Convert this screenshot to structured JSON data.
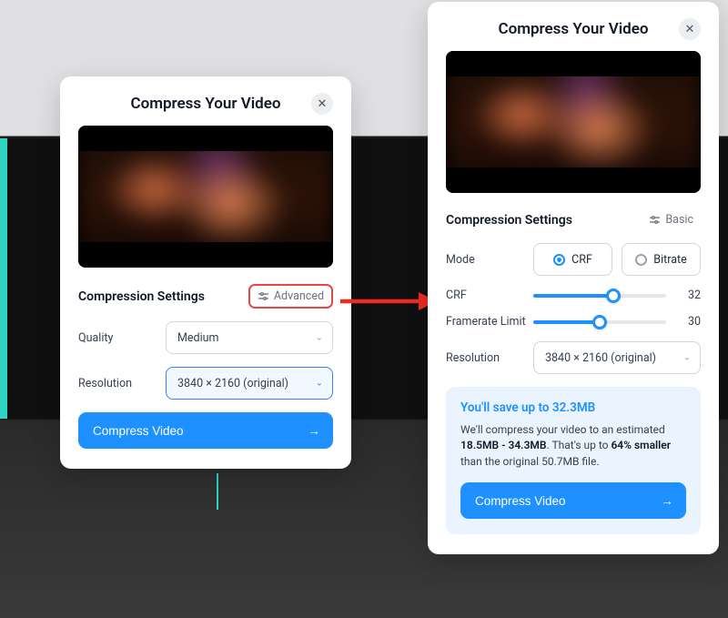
{
  "left": {
    "title": "Compress Your Video",
    "section": "Compression Settings",
    "toggle": "Advanced",
    "quality_label": "Quality",
    "quality_value": "Medium",
    "resolution_label": "Resolution",
    "resolution_value": "3840 × 2160 (original)",
    "button": "Compress Video"
  },
  "right": {
    "title": "Compress Your Video",
    "section": "Compression Settings",
    "toggle": "Basic",
    "mode_label": "Mode",
    "mode_crf": "CRF",
    "mode_bitrate": "Bitrate",
    "crf_label": "CRF",
    "crf_value": "32",
    "fps_label": "Framerate Limit",
    "fps_value": "30",
    "resolution_label": "Resolution",
    "resolution_value": "3840 × 2160 (original)",
    "info_title": "You'll save up to 32.3MB",
    "info_prefix": "We'll compress your video to an estimated ",
    "info_range": "18.5MB - 34.3MB",
    "info_mid": ". That's up to ",
    "info_pct": "64% smaller",
    "info_suffix": " than the original 50.7MB file.",
    "button": "Compress Video"
  },
  "colors": {
    "accent": "#1e90ff",
    "highlight": "#ef4444"
  }
}
